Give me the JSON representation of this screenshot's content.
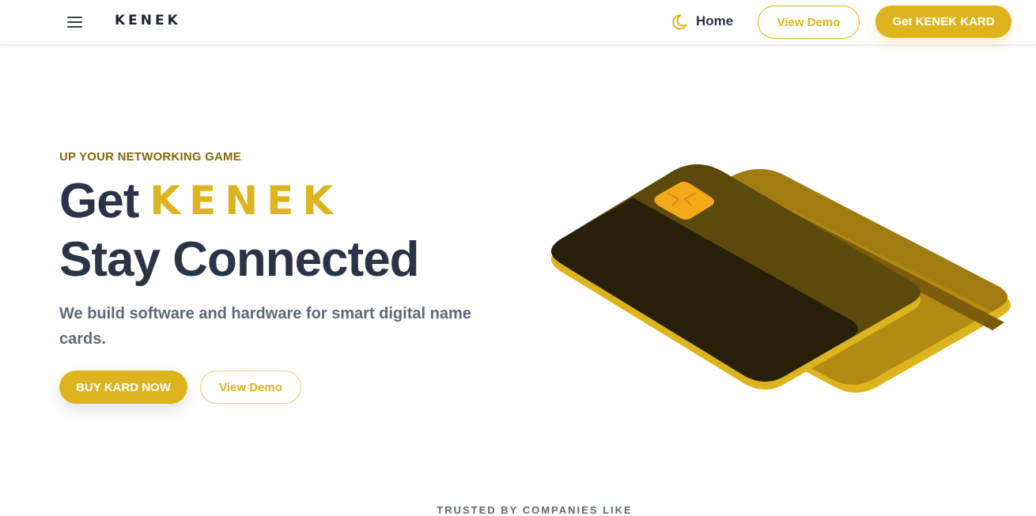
{
  "header": {
    "menu_icon": "hamburger-menu-icon",
    "logo": "KENEK",
    "theme_icon": "moon-icon",
    "nav_home": "Home",
    "view_demo": "View Demo",
    "get_kard": "Get KENEK KARD"
  },
  "hero": {
    "eyebrow": "UP YOUR NETWORKING GAME",
    "title_get": "Get",
    "title_brand": "KENEK",
    "title_line2": "Stay Connected",
    "subtitle": "We build software and hardware for smart digital name cards.",
    "buy_button": "BUY KARD NOW",
    "demo_button": "View Demo",
    "illustration": "business-cards-illustration"
  },
  "footer_teaser": {
    "trusted": "TRUSTED BY COMPANIES LIKE"
  },
  "colors": {
    "accent": "#ddb41d",
    "dark_text": "#2c3347",
    "eyebrow": "#86660b",
    "muted_text": "#5f6878"
  }
}
